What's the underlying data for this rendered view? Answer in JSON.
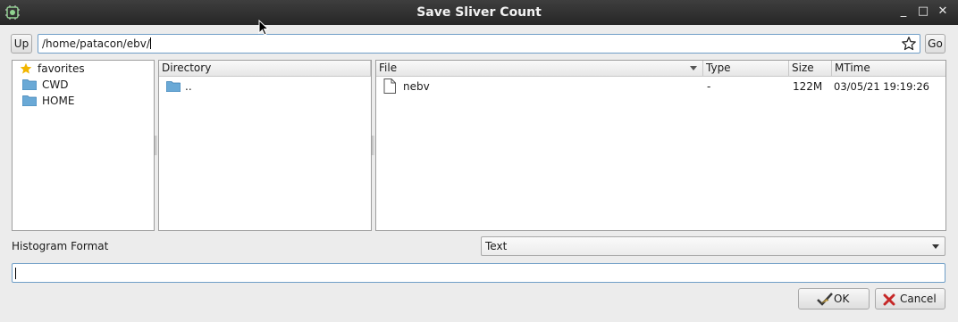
{
  "window": {
    "title": "Save Sliver Count",
    "controls": {
      "minimize": "_",
      "maximize": "□",
      "close": "✕"
    }
  },
  "toolbar": {
    "up_label": "Up",
    "path_value": "/home/patacon/ebv/",
    "go_label": "Go"
  },
  "sidebar": {
    "items": [
      {
        "label": "favorites",
        "icon": "star-icon"
      },
      {
        "label": "CWD",
        "icon": "folder-icon"
      },
      {
        "label": "HOME",
        "icon": "folder-icon"
      }
    ]
  },
  "directory": {
    "header": "Directory",
    "items": [
      {
        "label": ".."
      }
    ]
  },
  "files": {
    "headers": {
      "file": "File",
      "type": "Type",
      "size": "Size",
      "mtime": "MTime"
    },
    "rows": [
      {
        "name": "nebv",
        "type": "-",
        "size": "122M",
        "mtime": "03/05/21 19:19:26"
      }
    ]
  },
  "format": {
    "label": "Histogram Format",
    "selected": "Text"
  },
  "filename": {
    "value": ""
  },
  "actions": {
    "ok_label": "OK",
    "cancel_label": "Cancel"
  },
  "colors": {
    "titlebar": "#2e2e2e",
    "folder": "#6aa9d6",
    "focus": "#6f9ec7",
    "star": "#f2b600"
  }
}
